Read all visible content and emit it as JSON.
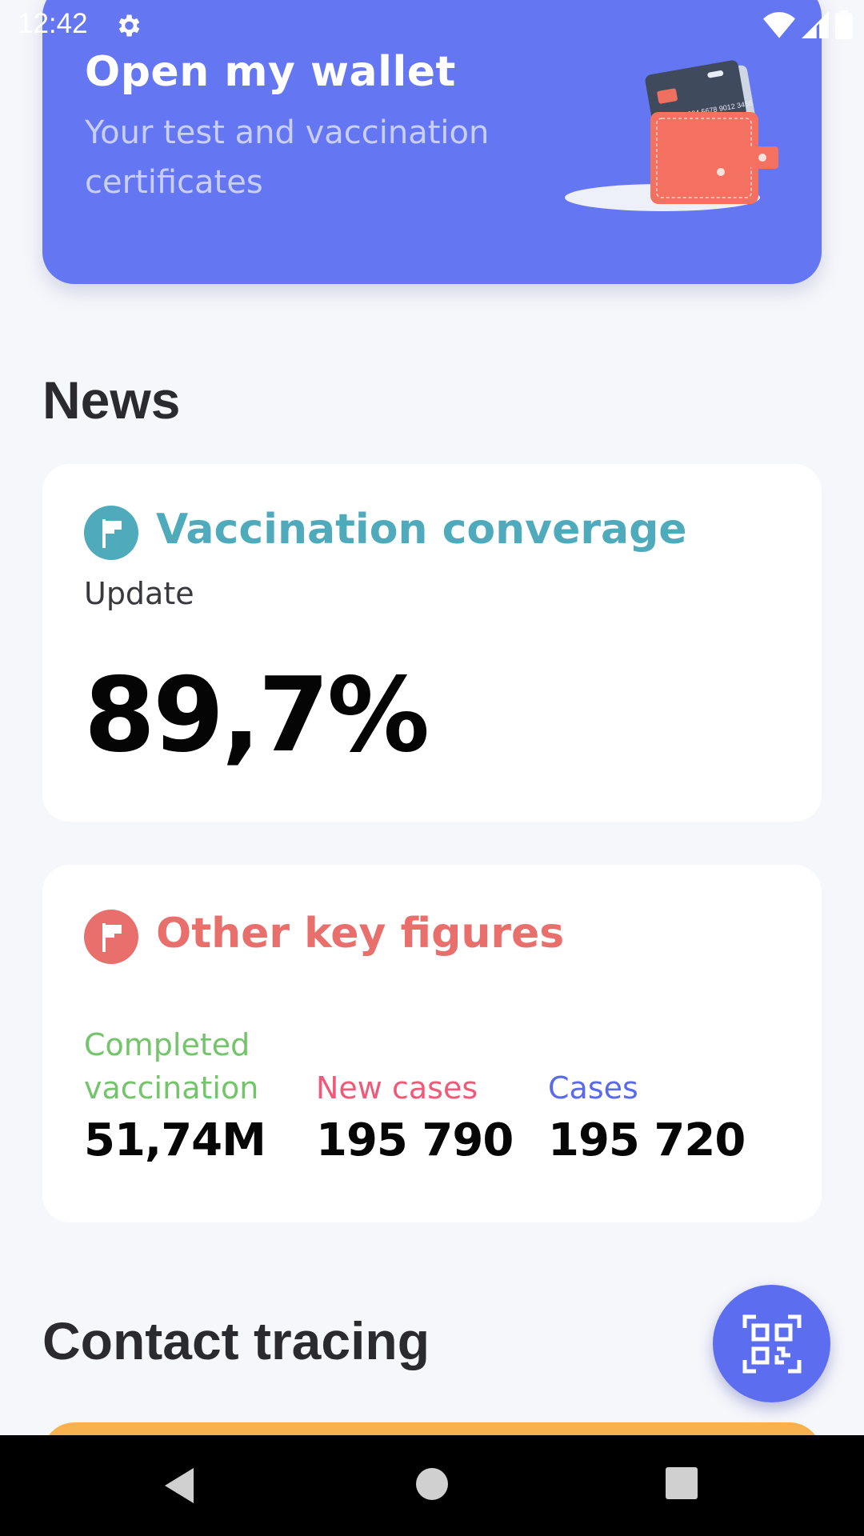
{
  "status_bar": {
    "time": "12:42",
    "icons": [
      "gear-icon",
      "wifi-icon",
      "signal-icon",
      "battery-icon"
    ]
  },
  "wallet": {
    "title": "Open my wallet",
    "subtitle": "Your test and vaccination certificates",
    "card_number_text": "1234 5678 9012 3456"
  },
  "news": {
    "section_title": "News",
    "coverage_card": {
      "title": "Vaccination converage",
      "subtitle": "Update",
      "value": "89,7%",
      "accent_color": "#4fabbb",
      "icon": "flag-icon"
    },
    "key_figures_card": {
      "title": "Other key figures",
      "accent_color": "#e86f6c",
      "icon": "flag-icon",
      "figures": [
        {
          "label": "Completed vaccination",
          "value": "51,74M",
          "color": "#74c46b"
        },
        {
          "label": "New cases",
          "value": "195 790",
          "color": "#ef5a78"
        },
        {
          "label": "Cases",
          "value": "195 720",
          "color": "#5a6bea"
        }
      ]
    }
  },
  "contact_tracing": {
    "section_title": "Contact tracing"
  },
  "fab": {
    "icon": "qr-code-icon"
  },
  "nav": {
    "icons": [
      "back-icon",
      "home-icon",
      "recents-icon"
    ]
  },
  "colors": {
    "primary": "#6576f3",
    "background": "#f6f7fb",
    "orange": "#f7b14e"
  }
}
